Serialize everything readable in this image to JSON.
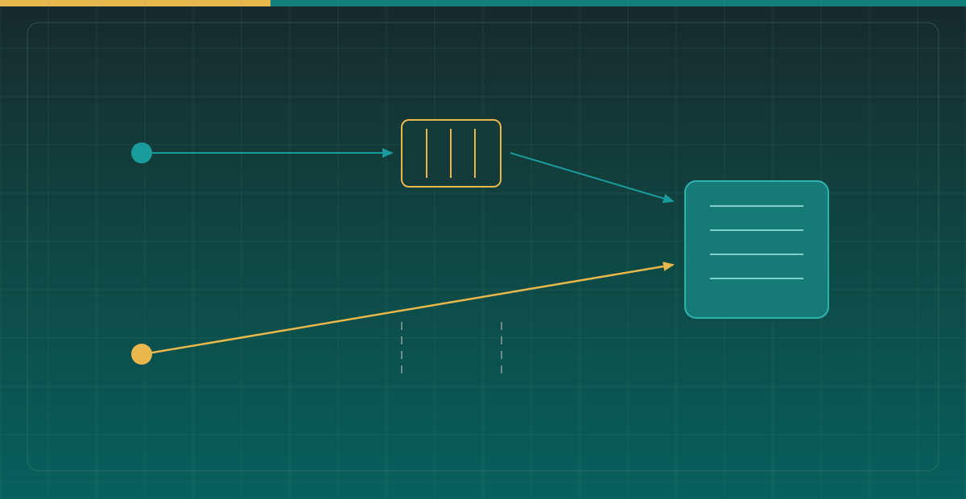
{
  "colors": {
    "accent_gold": "#e8b84d",
    "accent_teal": "#1a9b9b",
    "grid": "#5fa19b",
    "panel_border": "#5f8f8a",
    "queue_fill": "#143a3a",
    "store_fill": "#167a77",
    "store_border": "#2fb3ad",
    "store_lines": "#7fd1cc",
    "dash": "#8f9fa0"
  },
  "diagram": {
    "nodes": [
      {
        "id": "source-teal",
        "shape": "dot",
        "color": "teal"
      },
      {
        "id": "source-gold",
        "shape": "dot",
        "color": "gold"
      },
      {
        "id": "queue",
        "shape": "rounded-rect",
        "color": "gold",
        "inner_bars": 3
      },
      {
        "id": "store",
        "shape": "rounded-rect",
        "color": "teal",
        "inner_lines": 4
      }
    ],
    "edges": [
      {
        "from": "source-teal",
        "to": "queue",
        "color": "teal"
      },
      {
        "from": "queue",
        "to": "store",
        "color": "teal"
      },
      {
        "from": "source-gold",
        "to": "store",
        "color": "gold"
      }
    ],
    "dashed_markers": 2
  }
}
